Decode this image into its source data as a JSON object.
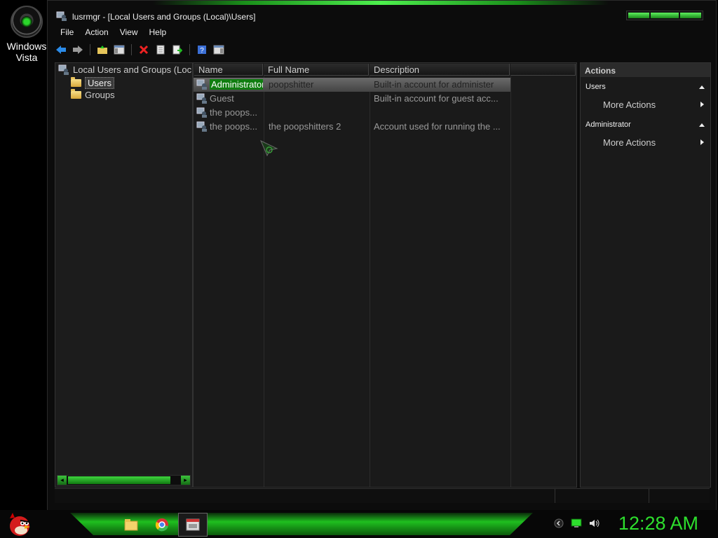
{
  "desktop": {
    "icon_label_line1": "Windows",
    "icon_label_line2": "Vista"
  },
  "window": {
    "title": "lusrmgr - [Local Users and Groups (Local)\\Users]"
  },
  "menu": [
    "File",
    "Action",
    "View",
    "Help"
  ],
  "tree": {
    "root": "Local Users and Groups (Loc",
    "items": [
      "Users",
      "Groups"
    ]
  },
  "list": {
    "columns": [
      "Name",
      "Full Name",
      "Description"
    ],
    "rows": [
      {
        "name": "Administrator",
        "full_name": "poopshitter",
        "description": "Built-in account for administer"
      },
      {
        "name": "Guest",
        "full_name": "",
        "description": "Built-in account for guest acc..."
      },
      {
        "name": "the poops...",
        "full_name": "",
        "description": ""
      },
      {
        "name": "the poops...",
        "full_name": "the poopshitters 2",
        "description": "Account used for running the ..."
      }
    ]
  },
  "actions": {
    "title": "Actions",
    "section1": "Users",
    "section1_item": "More Actions",
    "section2": "Administrator",
    "section2_item": "More Actions"
  },
  "taskbar": {
    "clock": "12:28 AM"
  },
  "colors": {
    "accent_green": "#2ddf2d",
    "selection_green": "#107d10"
  }
}
